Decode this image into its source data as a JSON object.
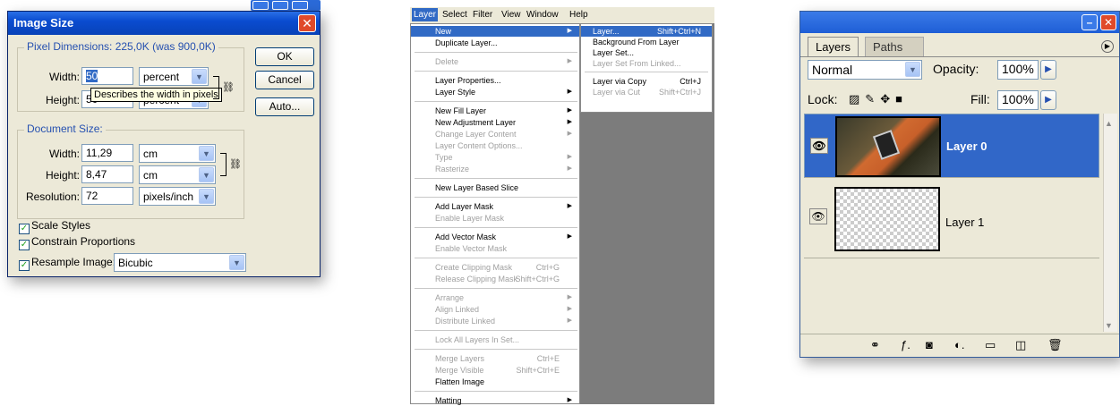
{
  "image_size_dialog": {
    "title": "Image Size",
    "close": "✕",
    "pixel_dimensions": {
      "legend": "Pixel Dimensions:  225,0K (was 900,0K)",
      "width_label": "Width:",
      "width_value": "50",
      "width_unit": "percent",
      "height_label": "Height:",
      "height_value": "50",
      "height_unit": "percent",
      "tooltip": "Describes the width in pixels"
    },
    "document_size": {
      "legend": "Document Size:",
      "width_label": "Width:",
      "width_value": "11,29",
      "width_unit": "cm",
      "height_label": "Height:",
      "height_value": "8,47",
      "height_unit": "cm",
      "resolution_label": "Resolution:",
      "resolution_value": "72",
      "resolution_unit": "pixels/inch"
    },
    "buttons": {
      "ok": "OK",
      "cancel": "Cancel",
      "auto": "Auto..."
    },
    "checkboxes": {
      "scale_styles": "Scale Styles",
      "constrain_proportions": "Constrain Proportions",
      "resample_image": "Resample Image:"
    },
    "resample_method": "Bicubic",
    "check_mark": "✓",
    "dropdown_glyph": "▼"
  },
  "menu": {
    "menubar": [
      "Layer",
      "Select",
      "Filter",
      "View",
      "Window",
      "Help"
    ],
    "layer_items": [
      {
        "label": "New",
        "highlighted": true,
        "submenu": true
      },
      {
        "label": "Duplicate Layer..."
      },
      {
        "label": "Delete",
        "disabled": true,
        "submenu": true
      },
      {
        "label": "Layer Properties..."
      },
      {
        "label": "Layer Style",
        "submenu": true
      },
      {
        "label": "New Fill Layer",
        "submenu": true
      },
      {
        "label": "New Adjustment Layer",
        "submenu": true
      },
      {
        "label": "Change Layer Content",
        "disabled": true,
        "submenu": true
      },
      {
        "label": "Layer Content Options...",
        "disabled": true
      },
      {
        "label": "Type",
        "disabled": true,
        "submenu": true
      },
      {
        "label": "Rasterize",
        "disabled": true,
        "submenu": true
      },
      {
        "label": "New Layer Based Slice"
      },
      {
        "label": "Add Layer Mask",
        "submenu": true
      },
      {
        "label": "Enable Layer Mask",
        "disabled": true
      },
      {
        "label": "Add Vector Mask",
        "submenu": true
      },
      {
        "label": "Enable Vector Mask",
        "disabled": true
      },
      {
        "label": "Create Clipping Mask",
        "disabled": true,
        "shortcut": "Ctrl+G"
      },
      {
        "label": "Release Clipping Mask",
        "disabled": true,
        "shortcut": "Shift+Ctrl+G"
      },
      {
        "label": "Arrange",
        "disabled": true,
        "submenu": true
      },
      {
        "label": "Align Linked",
        "disabled": true,
        "submenu": true
      },
      {
        "label": "Distribute Linked",
        "disabled": true,
        "submenu": true
      },
      {
        "label": "Lock All Layers In Set...",
        "disabled": true
      },
      {
        "label": "Merge Layers",
        "disabled": true,
        "shortcut": "Ctrl+E"
      },
      {
        "label": "Merge Visible",
        "disabled": true,
        "shortcut": "Shift+Ctrl+E"
      },
      {
        "label": "Flatten Image"
      },
      {
        "label": "Matting",
        "submenu": true
      }
    ],
    "new_submenu": [
      {
        "label": "Layer...",
        "shortcut": "Shift+Ctrl+N",
        "highlighted": true
      },
      {
        "label": "Background From Layer"
      },
      {
        "label": "Layer Set..."
      },
      {
        "label": "Layer Set From Linked...",
        "disabled": true
      },
      {
        "label": "Layer via Copy",
        "shortcut": "Ctrl+J"
      },
      {
        "label": "Layer via Cut",
        "shortcut": "Shift+Ctrl+J",
        "disabled": true
      }
    ]
  },
  "layers_palette": {
    "tabs": [
      "Layers",
      "Paths"
    ],
    "blend_mode": "Normal",
    "opacity_label": "Opacity:",
    "opacity_value": "100%",
    "lock_label": "Lock:",
    "fill_label": "Fill:",
    "fill_value": "100%",
    "layers": [
      {
        "name": "Layer 0",
        "selected": true
      },
      {
        "name": "Layer 1",
        "selected": false
      }
    ],
    "colors": {
      "selected_row": "#3167c8",
      "title_bar": "#1e5ed6"
    }
  }
}
